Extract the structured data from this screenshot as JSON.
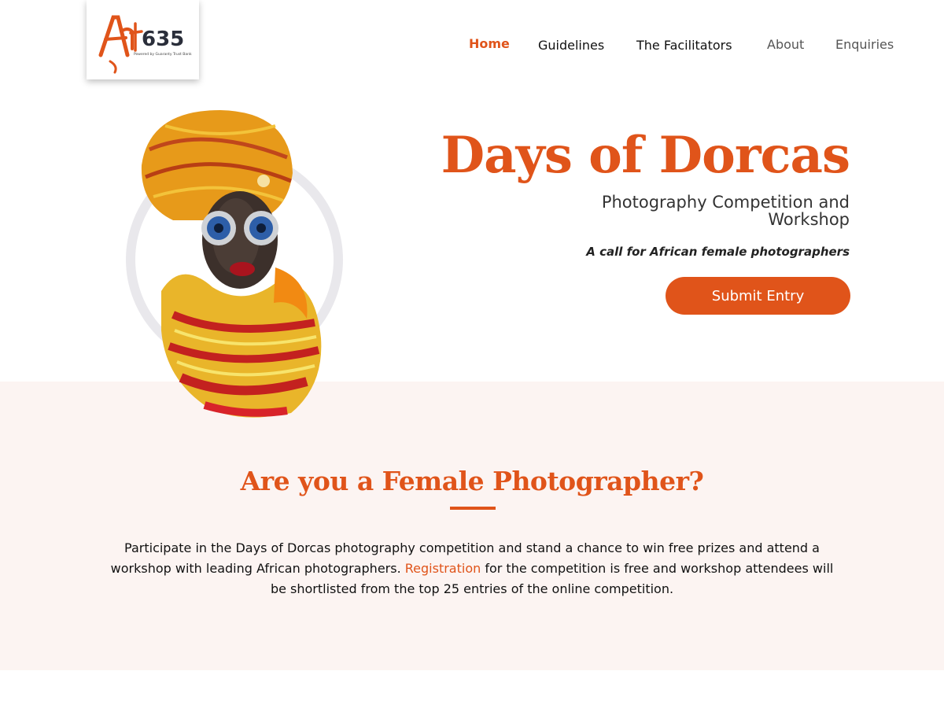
{
  "brand": {
    "logo_text": "Art635",
    "logo_tagline": "Powered by Guaranty Trust Bank"
  },
  "nav": {
    "items": [
      {
        "label": "Home",
        "active": true
      },
      {
        "label": "Guidelines",
        "active": false
      },
      {
        "label": "The Facilitators",
        "active": false
      },
      {
        "label": "About",
        "active": false
      },
      {
        "label": "Enquiries",
        "active": false
      }
    ]
  },
  "hero": {
    "title": "Days of Dorcas",
    "subtitle": "Photography Competition and Workshop",
    "tagline": "A call for African female photographers",
    "cta_label": "Submit Entry",
    "image_icon": "portrait-illustration-icon"
  },
  "section": {
    "title": "Are you a Female Photographer?",
    "body_before": "Participate in the Days of Dorcas photography competition and stand a chance to win free prizes and attend a workshop with leading African photographers.",
    "link_text": "Registration",
    "body_after": "for the competition is free and workshop attendees will be shortlisted from the top 25 entries of the online competition."
  },
  "colors": {
    "accent": "#e0541a",
    "section_bg": "#fcf4f2",
    "text": "#111111"
  }
}
